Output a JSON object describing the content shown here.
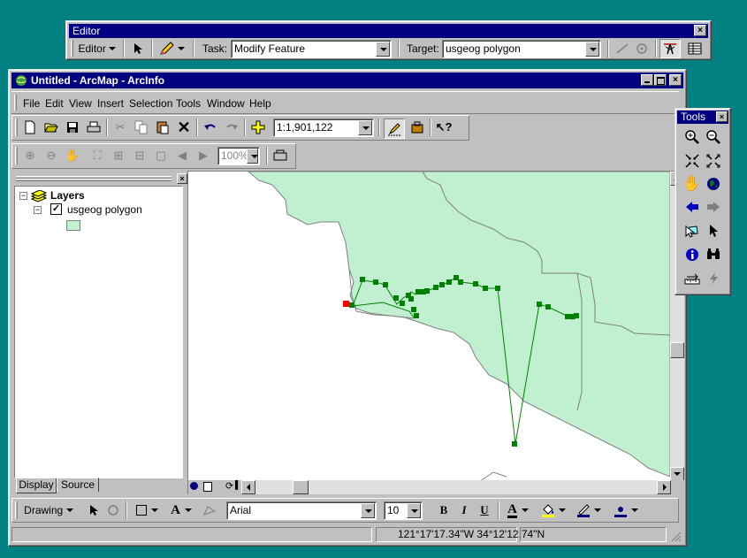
{
  "editor_toolbar": {
    "title": "Editor",
    "editor_menu": "Editor",
    "task_label": "Task:",
    "task_value": "Modify Feature",
    "target_label": "Target:",
    "target_value": "usgeog polygon"
  },
  "window": {
    "title": "Untitled - ArcMap - ArcInfo",
    "menu": [
      "File",
      "Edit",
      "View",
      "Insert",
      "Selection",
      "Tools",
      "Window",
      "Help"
    ],
    "scale": "1:1,901,122",
    "zoom_percent": "100%"
  },
  "toc": {
    "root_label": "Layers",
    "layer_name": "usgeog polygon",
    "layer_checked": true,
    "symbol_color": "#c0f0d0",
    "tabs": [
      "Display",
      "Source"
    ],
    "active_tab": "Display"
  },
  "map": {
    "polygon_color": "#c0f0d0",
    "line_color": "#808080",
    "edit_vertex_color": "#008000",
    "start_vertex_color": "#ff0000"
  },
  "tools_toolbar": {
    "title": "Tools",
    "icons": [
      "zoom-in-icon",
      "zoom-out-icon",
      "fixed-zoom-in-icon",
      "fixed-zoom-out-icon",
      "pan-icon",
      "full-extent-icon",
      "back-extent-icon",
      "forward-extent-icon",
      "select-features-icon",
      "select-elements-icon",
      "identify-icon",
      "find-icon",
      "measure-icon",
      "hyperlink-icon"
    ]
  },
  "drawing_toolbar": {
    "drawing_menu": "Drawing",
    "font": "Arial",
    "font_size": "10",
    "bold": "B",
    "italic": "I",
    "underline": "U"
  },
  "status_bar": {
    "coords": "121°17'17.34\"W  34°12'12.74\"N"
  }
}
